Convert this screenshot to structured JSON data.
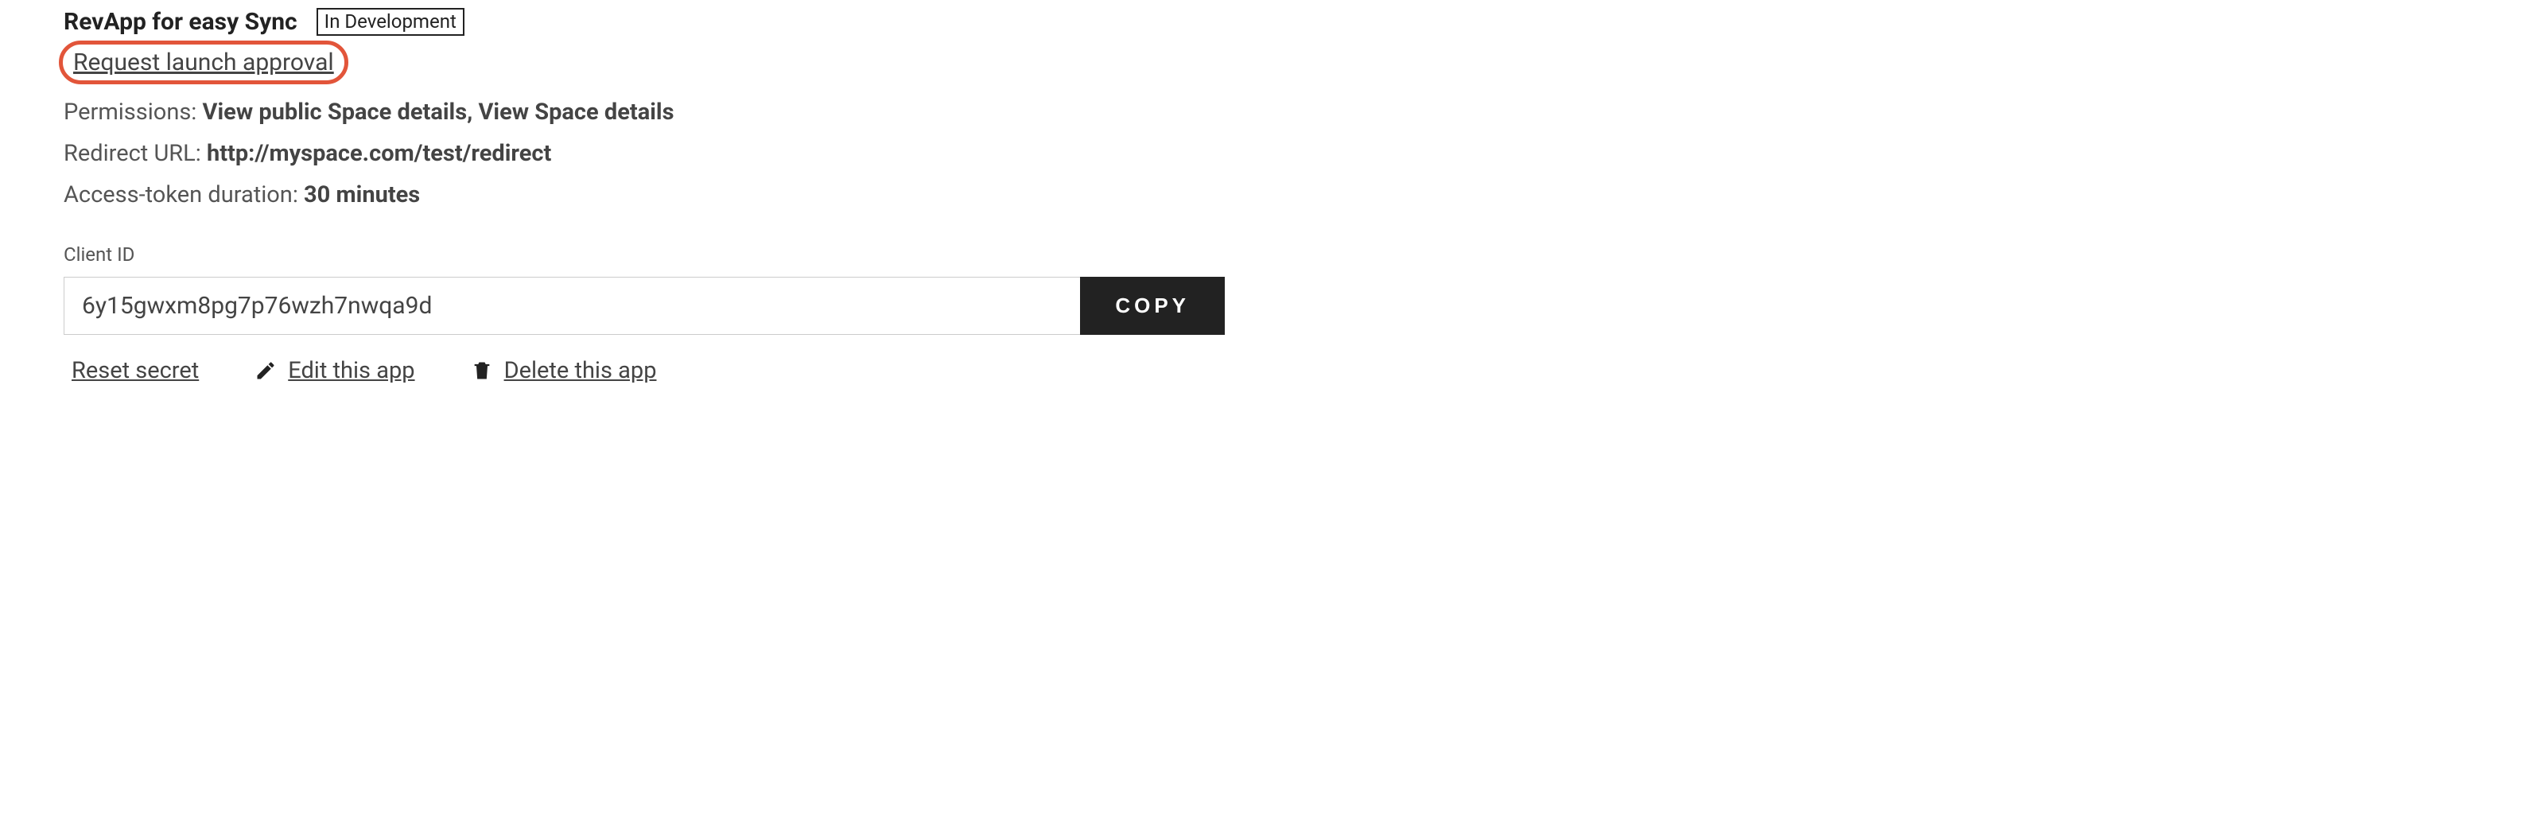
{
  "app": {
    "title": "RevApp for easy Sync",
    "status": "In Development"
  },
  "links": {
    "request_launch": "Request launch approval"
  },
  "details": {
    "permissions_label": "Permissions:",
    "permissions_value": "View public Space details, View Space details",
    "redirect_label": "Redirect URL:",
    "redirect_value": "http://myspace.com/test/redirect",
    "token_label": "Access-token duration:",
    "token_value": "30 minutes"
  },
  "client_id": {
    "label": "Client ID",
    "value": "6y15gwxm8pg7p76wzh7nwqa9d",
    "copy_label": "COPY"
  },
  "actions": {
    "reset_secret": "Reset secret",
    "edit_app": "Edit this app",
    "delete_app": "Delete this app"
  }
}
